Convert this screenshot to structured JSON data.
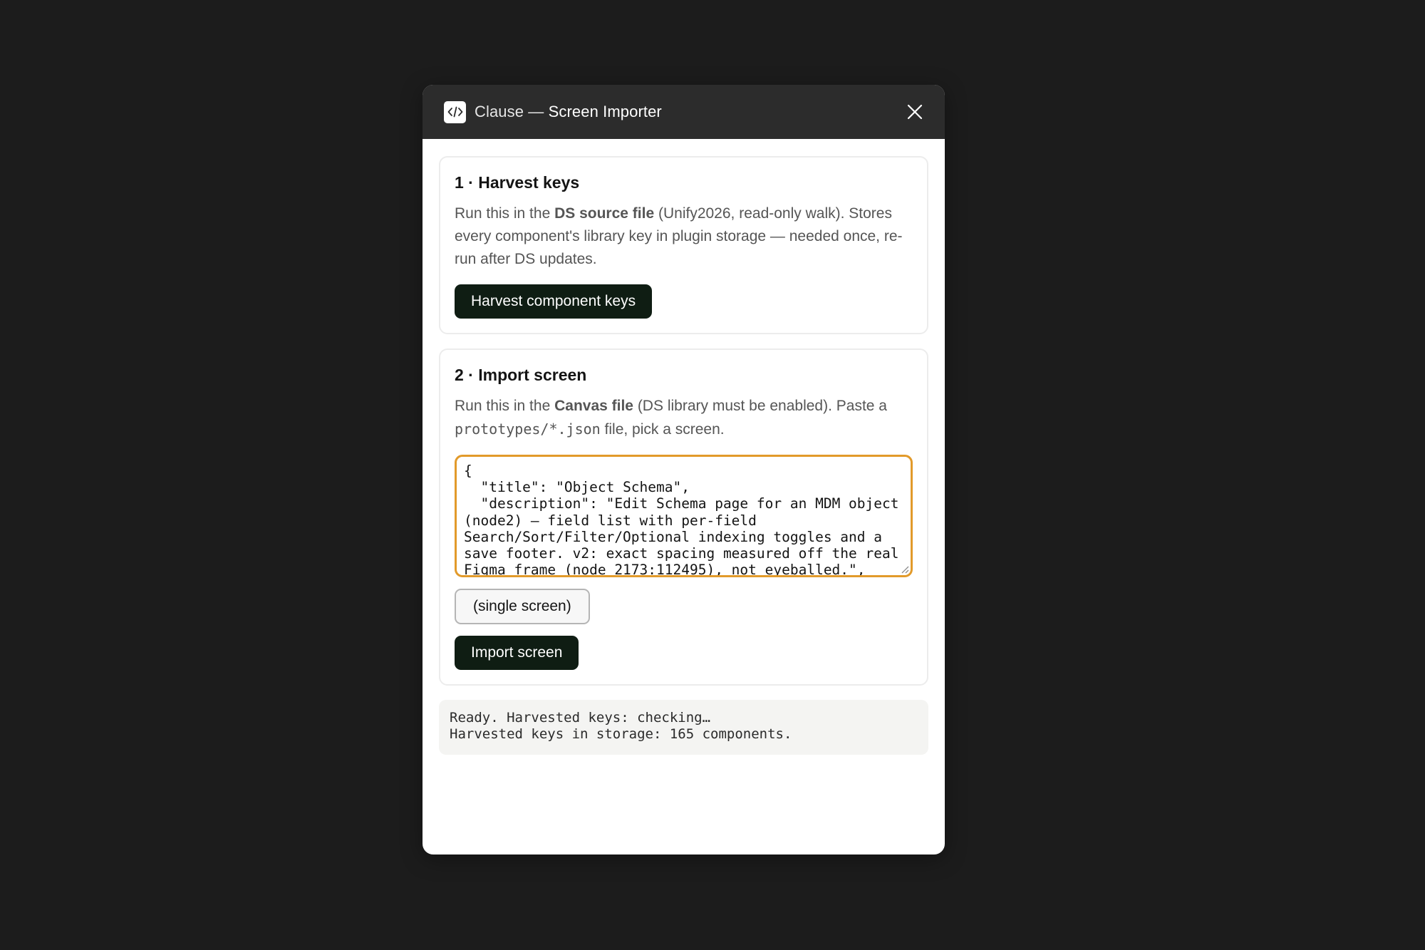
{
  "window": {
    "title_prefix": "Clause",
    "title_separator": " — ",
    "title_main": "Screen Importer",
    "app_icon": "code-brackets-icon",
    "close_icon": "close-icon"
  },
  "harvest": {
    "heading": "1 · Harvest keys",
    "desc_1": "Run this in the ",
    "desc_bold": "DS source file",
    "desc_2": " (Unify2026, read-only walk). Stores every component's library key in plugin storage — needed once, re-run after DS updates.",
    "button_label": "Harvest component keys"
  },
  "import": {
    "heading": "2 · Import screen",
    "desc_1": "Run this in the ",
    "desc_bold": "Canvas file",
    "desc_2": " (DS library must be enabled). Paste a ",
    "desc_code": "prototypes/*.json",
    "desc_3": " file, pick a screen.",
    "json_value": "{\n  \"title\": \"Object Schema\",\n  \"description\": \"Edit Schema page for an MDM object (node2) — field list with per-field Search/Sort/Filter/Optional indexing toggles and a save footer. v2: exact spacing measured off the real Figma frame (node 2173:112495), not eyeballed.\",",
    "screen_select_value": "(single screen)",
    "button_label": "Import screen"
  },
  "status": {
    "line_1": "Ready. Harvested keys: checking…",
    "line_2": "Harvested keys in storage: 165 components."
  },
  "colors": {
    "page_bg": "#1c1c1c",
    "titlebar_bg": "#2c2c2c",
    "primary_button": "#0f1d13",
    "focus_border": "#e29a2a"
  }
}
